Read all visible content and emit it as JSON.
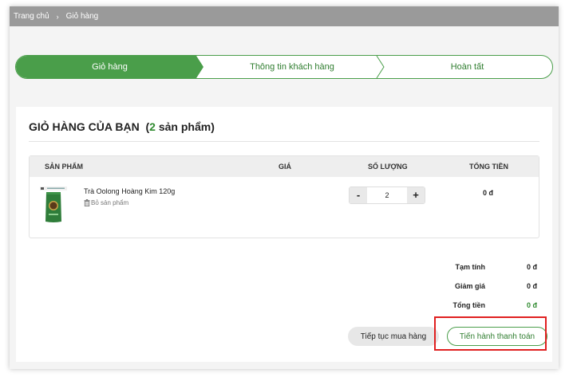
{
  "breadcrumb": {
    "home": "Trang chủ",
    "separator": "›",
    "current": "Giỏ hàng"
  },
  "steps": [
    {
      "label": "Giỏ hàng",
      "active": true
    },
    {
      "label": "Thông tin khách hàng",
      "active": false
    },
    {
      "label": "Hoàn tất",
      "active": false
    }
  ],
  "cart": {
    "title": "GIỎ HÀNG CỦA BẠN",
    "count_open": "(",
    "count": "2",
    "count_suffix": "sản phẩm)"
  },
  "table": {
    "headers": {
      "product": "SẢN PHẨM",
      "price": "GIÁ",
      "quantity": "SỐ LƯỢNG",
      "total": "TỔNG TIỀN"
    },
    "items": [
      {
        "name": "Trà Oolong Hoàng Kim 120g",
        "remove_label": "Bỏ sản phẩm",
        "price": "",
        "quantity": "2",
        "total": "0 đ"
      }
    ],
    "minus": "-",
    "plus": "+"
  },
  "summary": {
    "subtotal_label": "Tạm tính",
    "subtotal": "0 đ",
    "discount_label": "Giảm giá",
    "discount": "0 đ",
    "total_label": "Tổng tiền",
    "total": "0 đ"
  },
  "buttons": {
    "continue": "Tiếp tục mua hàng",
    "checkout": "Tiến hành thanh toán"
  },
  "colors": {
    "brand_green": "#4a9e4a",
    "highlight_red": "#e02020"
  }
}
